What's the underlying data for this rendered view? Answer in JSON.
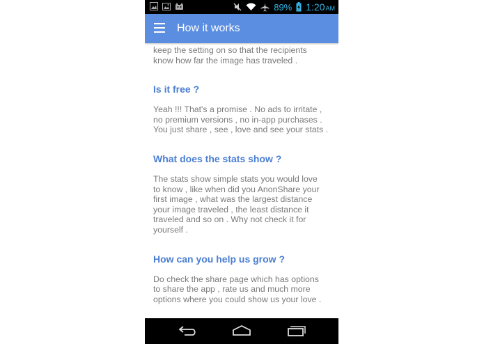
{
  "status_bar": {
    "battery_percent": "89%",
    "time": "1:20",
    "ampm": "AM",
    "accent_color": "#33b5e5",
    "icons_left": [
      "image-icon",
      "gallery-icon",
      "cat-icon"
    ],
    "icons_right": [
      "muted-icon",
      "wifi-icon",
      "airplane-icon",
      "battery-charging-icon"
    ]
  },
  "app_bar": {
    "title": "How it works",
    "color": "#5b8ee0",
    "menu_icon": "hamburger-menu-icon"
  },
  "content": {
    "intro_lines": [
      "keep the setting on so that the recipients",
      "know how far the image has traveled ."
    ],
    "sections": [
      {
        "question": "Is it free ?",
        "lines": [
          "Yeah !!! That's a promise . No ads to irritate ,",
          "no premium versions , no in-app purchases .",
          "You just share , see , love and see your stats ."
        ]
      },
      {
        "question": "What does the stats show ?",
        "lines": [
          "The stats show simple stats you would love",
          "to know , like when did you AnonShare your",
          "first image , what was the largest distance",
          "your image traveled , the least distance it",
          "traveled and so on . Why not check it for",
          "yourself ."
        ]
      },
      {
        "question": "How can you help us grow ?",
        "lines": [
          "Do check the share page which has options",
          "to share the app , rate us and much more",
          "options where you could show us your love ."
        ]
      }
    ],
    "question_color": "#4a7ed2",
    "text_color": "#7a7a7a"
  },
  "nav_bar": {
    "icons": [
      "back-icon",
      "home-icon",
      "recent-apps-icon"
    ]
  }
}
